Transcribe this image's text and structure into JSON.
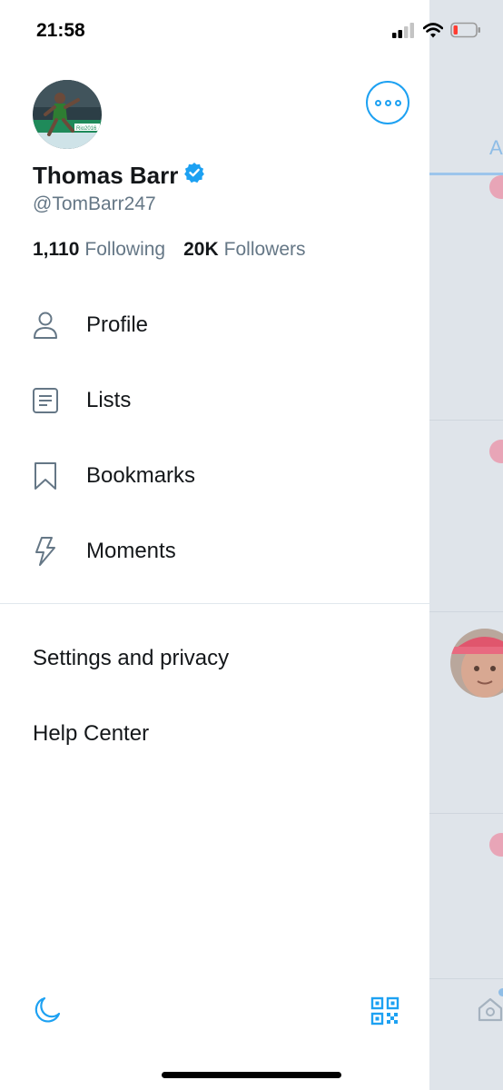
{
  "status_bar": {
    "time": "21:58"
  },
  "profile": {
    "display_name": "Thomas Barr",
    "handle": "@TomBarr247",
    "following_count": "1,110",
    "following_label": "Following",
    "followers_count": "20K",
    "followers_label": "Followers",
    "avatar_text": "Rio2016"
  },
  "menu": {
    "items": [
      {
        "label": "Profile",
        "icon": "person-icon"
      },
      {
        "label": "Lists",
        "icon": "list-icon"
      },
      {
        "label": "Bookmarks",
        "icon": "bookmark-icon"
      },
      {
        "label": "Moments",
        "icon": "lightning-icon"
      }
    ],
    "settings_label": "Settings and privacy",
    "help_label": "Help Center"
  },
  "background": {
    "tab_letter": "A"
  },
  "colors": {
    "accent": "#1da1f2",
    "secondary_text": "#657786",
    "primary_text": "#14171a",
    "dim_overlay": "#dfe4ea"
  }
}
